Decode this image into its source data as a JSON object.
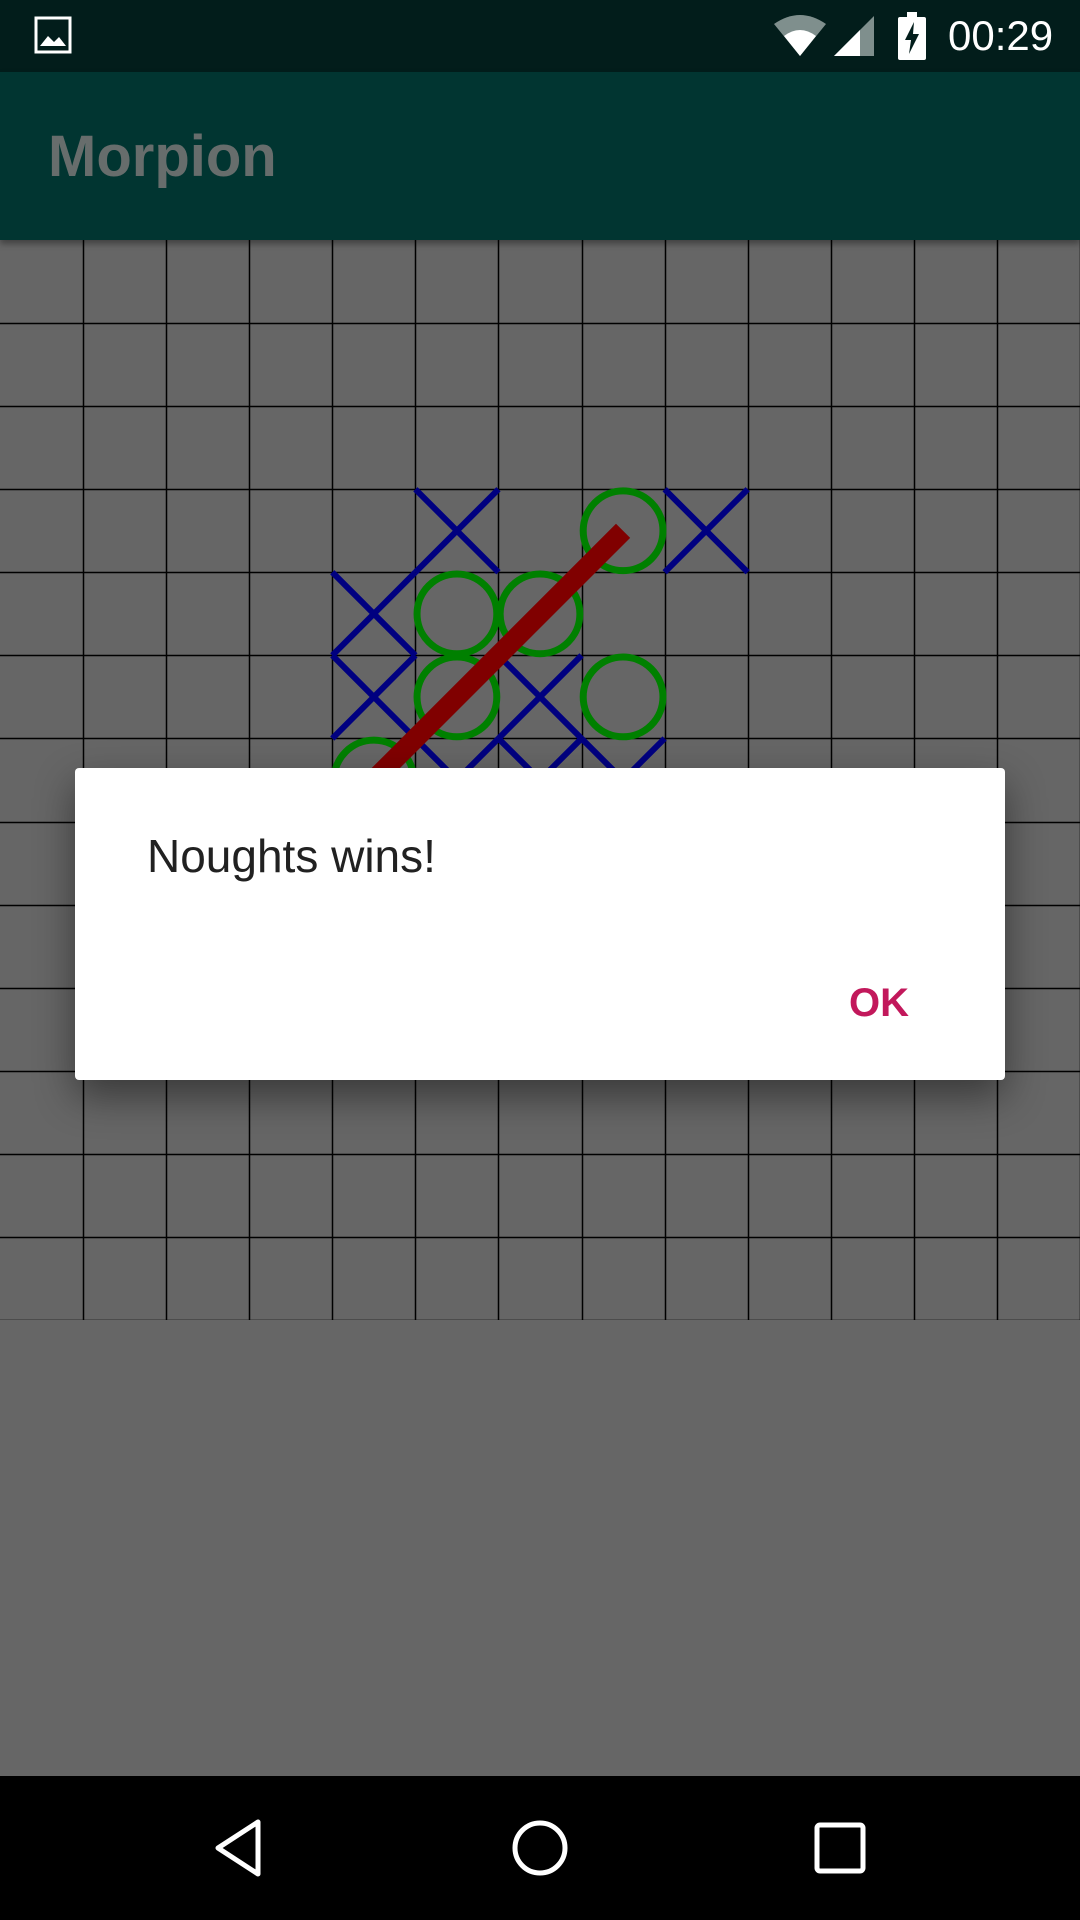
{
  "status_bar": {
    "time": "00:29",
    "icons": [
      "gallery-notification-icon",
      "wifi-icon",
      "cell-signal-icon",
      "battery-charging-icon"
    ]
  },
  "app_bar": {
    "title": "Morpion"
  },
  "board": {
    "rows": 13,
    "cols": 13,
    "crosses": [
      [
        3,
        5
      ],
      [
        3,
        8
      ],
      [
        4,
        4
      ],
      [
        5,
        4
      ],
      [
        5,
        6
      ],
      [
        6,
        5
      ],
      [
        6,
        6
      ],
      [
        6,
        7
      ]
    ],
    "noughts": [
      [
        3,
        7
      ],
      [
        4,
        5
      ],
      [
        4,
        6
      ],
      [
        5,
        5
      ],
      [
        5,
        7
      ],
      [
        6,
        4
      ]
    ],
    "winning_line": [
      [
        3,
        7
      ],
      [
        4,
        6
      ],
      [
        5,
        5
      ],
      [
        6,
        4
      ]
    ],
    "colors": {
      "grid_line": "#000000",
      "cross": "#000080",
      "nought": "#008000",
      "win_line": "#800000",
      "background": "#666666"
    }
  },
  "dialog": {
    "message": "Noughts wins!",
    "ok_label": "OK",
    "ok_color": "#c2185b"
  },
  "nav_bar": {
    "buttons": [
      "back-icon",
      "home-icon",
      "recents-icon"
    ]
  }
}
